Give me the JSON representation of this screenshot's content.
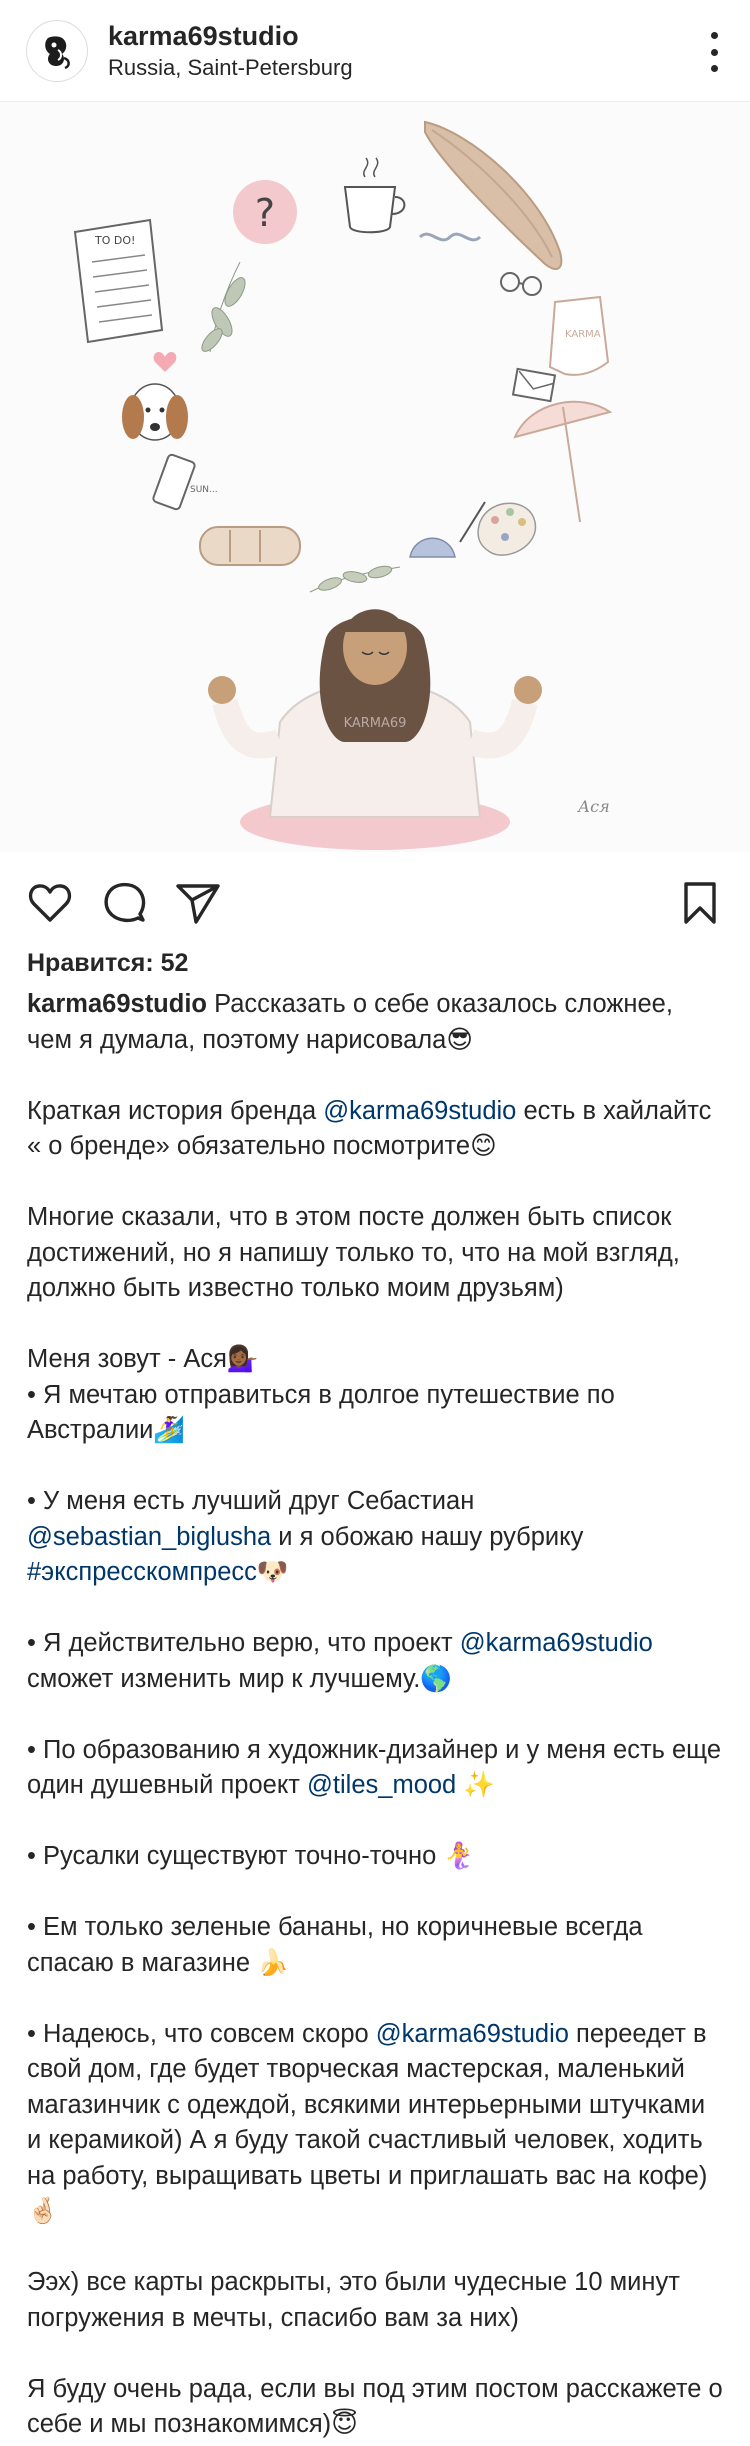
{
  "header": {
    "username": "karma69studio",
    "location": "Russia, Saint-Petersburg",
    "more_icon": "more-vertical-icon"
  },
  "media": {
    "kind": "illustration",
    "labels": {
      "todo": "TO DO!",
      "sweater": "KARMA69",
      "swimsuit": "KARMA",
      "note": "SUN...",
      "signature": "Ася"
    },
    "colors": {
      "pink": "#f4c9cd",
      "sand": "#d9bfa8",
      "hair": "#6b5344",
      "skin": "#c7a07a"
    }
  },
  "actions": {
    "like_icon": "heart-icon",
    "comment_icon": "comment-icon",
    "share_icon": "send-icon",
    "save_icon": "bookmark-icon"
  },
  "likes": {
    "text": "Нравится: 52"
  },
  "caption": {
    "username": "karma69studio",
    "lines": [
      {
        "type": "rich",
        "parts": [
          [
            "text",
            "Рассказать о себе оказалось сложнее, чем я думала, поэтому нарисовала😎"
          ]
        ]
      },
      {
        "type": "gap"
      },
      {
        "type": "rich",
        "parts": [
          [
            "text",
            "Краткая история бренда "
          ],
          [
            "link",
            "@karma69studio"
          ],
          [
            "text",
            " есть в хайлайтс « о бренде» обязательно посмотрите😊"
          ]
        ]
      },
      {
        "type": "gap"
      },
      {
        "type": "rich",
        "parts": [
          [
            "text",
            "Многие сказали, что в этом посте должен быть список достижений, но я напишу только то, что на мой взгляд, должно быть известно только моим друзьям)"
          ]
        ]
      },
      {
        "type": "gap"
      },
      {
        "type": "rich",
        "parts": [
          [
            "text",
            "Меня зовут - Ася💁🏾‍♀️"
          ]
        ]
      },
      {
        "type": "rich",
        "parts": [
          [
            "text",
            "• Я мечтаю отправиться в долгое путешествие по Австралии🏄‍♀️"
          ]
        ]
      },
      {
        "type": "gap"
      },
      {
        "type": "rich",
        "parts": [
          [
            "text",
            "• У меня есть лучший друг Себастиан "
          ],
          [
            "link",
            "@sebastian_biglusha"
          ],
          [
            "text",
            " и я обожаю нашу рубрику "
          ],
          [
            "link",
            "#экспресскомпресс"
          ],
          [
            "text",
            "🐶"
          ]
        ]
      },
      {
        "type": "gap"
      },
      {
        "type": "rich",
        "parts": [
          [
            "text",
            "• Я действительно верю, что проект "
          ],
          [
            "link",
            "@karma69studio"
          ],
          [
            "text",
            " сможет изменить мир к лучшему.🌎"
          ]
        ]
      },
      {
        "type": "gap"
      },
      {
        "type": "rich",
        "parts": [
          [
            "text",
            "• По образованию я художник-дизайнер и у меня есть еще один душевный проект "
          ],
          [
            "link",
            "@tiles_mood"
          ],
          [
            "text",
            " ✨"
          ]
        ]
      },
      {
        "type": "gap"
      },
      {
        "type": "rich",
        "parts": [
          [
            "text",
            "• Русалки существуют точно-точно 🧜‍♀️"
          ]
        ]
      },
      {
        "type": "gap"
      },
      {
        "type": "rich",
        "parts": [
          [
            "text",
            "• Ем только зеленые бананы, но коричневые всегда спасаю в магазине 🍌"
          ]
        ]
      },
      {
        "type": "gap"
      },
      {
        "type": "rich",
        "parts": [
          [
            "text",
            "• Надеюсь, что совсем скоро "
          ],
          [
            "link",
            "@karma69studio"
          ],
          [
            "text",
            " переедет в свой дом, где будет творческая мастерская, маленький магазинчик с одеждой, всякими интерьерными штучками и керамикой) А я буду такой счастливый человек, ходить на работу, выращивать цветы и приглашать вас на кофе)🤞🏻"
          ]
        ]
      },
      {
        "type": "gap"
      },
      {
        "type": "rich",
        "parts": [
          [
            "text",
            "Ээх) все карты раскрыты, это были чудесные 10 минут погружения в мечты, спасибо вам за них)"
          ]
        ]
      },
      {
        "type": "gap"
      },
      {
        "type": "rich",
        "parts": [
          [
            "text",
            "Я буду очень рада, если вы под этим постом расскажете о себе и мы познакомимся)😇"
          ]
        ]
      }
    ]
  }
}
